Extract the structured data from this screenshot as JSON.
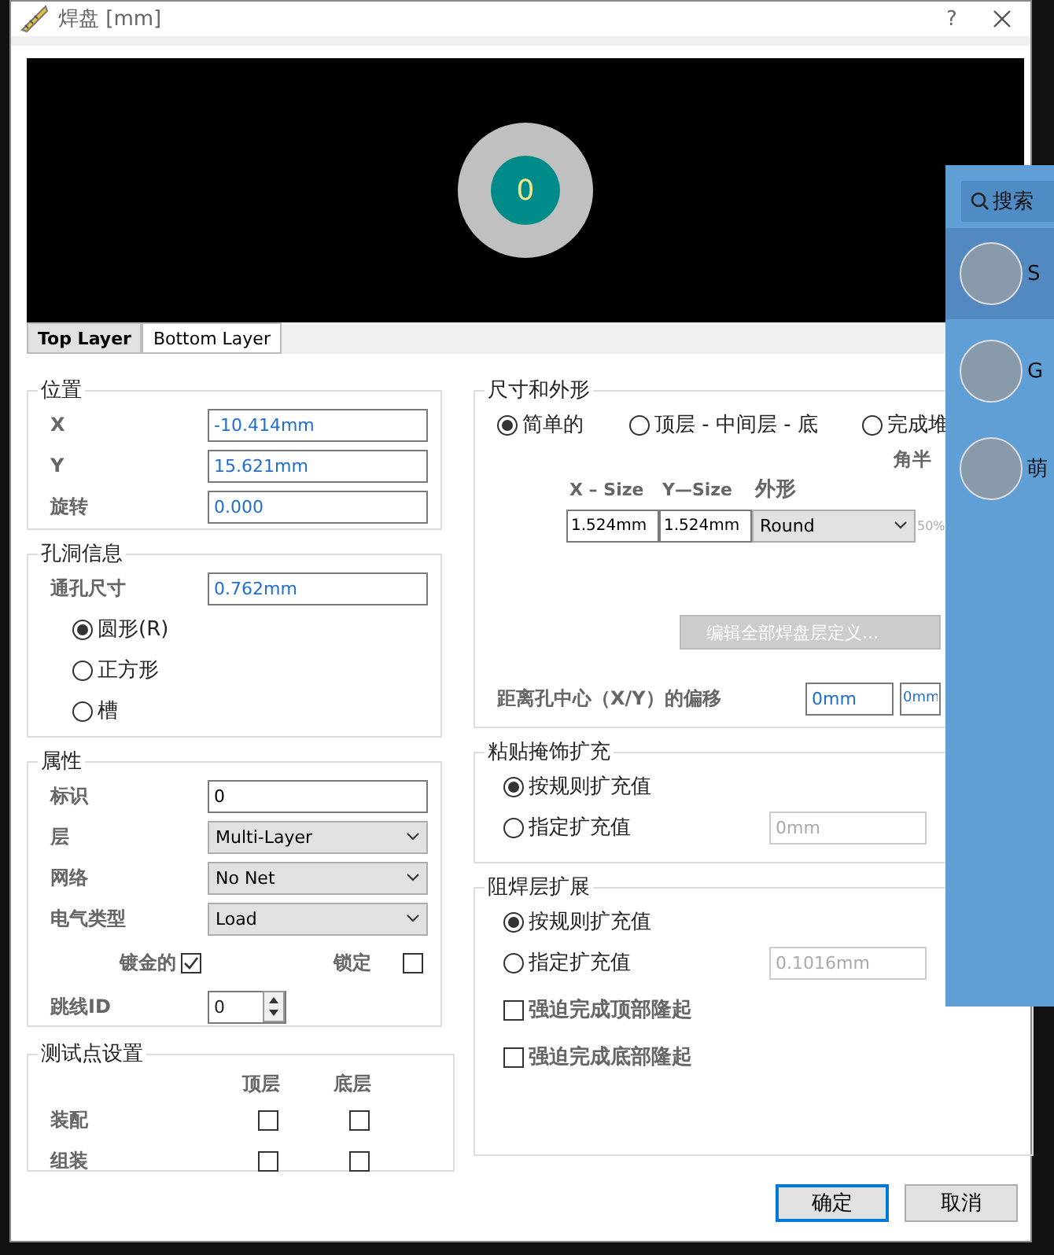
{
  "window": {
    "title": "焊盘 [mm]",
    "help": "?"
  },
  "preview": {
    "pad_label": "0",
    "tabs": [
      {
        "label": "Top Layer",
        "selected": true
      },
      {
        "label": "Bottom Layer",
        "selected": false
      }
    ]
  },
  "position": {
    "title": "位置",
    "fields": [
      {
        "label": "X",
        "value": "-10.414mm"
      },
      {
        "label": "Y",
        "value": "15.621mm"
      },
      {
        "label": "旋转",
        "value": "0.000"
      }
    ]
  },
  "hole": {
    "title": "孔洞信息",
    "size_label": "通孔尺寸",
    "size_value": "0.762mm",
    "shapes": [
      {
        "label": "圆形(R)",
        "selected": true
      },
      {
        "label": "正方形",
        "selected": false
      },
      {
        "label": "槽",
        "selected": false
      }
    ]
  },
  "properties": {
    "title": "属性",
    "fields": [
      {
        "kind": "input",
        "label": "标识",
        "value": "0"
      },
      {
        "kind": "select",
        "label": "层",
        "value": "Multi-Layer"
      },
      {
        "kind": "select",
        "label": "网络",
        "value": "No Net"
      },
      {
        "kind": "select",
        "label": "电气类型",
        "value": "Load"
      }
    ],
    "plated": {
      "label": "镀金的",
      "checked": true
    },
    "locked": {
      "label": "锁定",
      "checked": false
    },
    "jumper": {
      "label": "跳线ID",
      "value": "0"
    }
  },
  "testpoint": {
    "title": "测试点设置",
    "columns": [
      "顶层",
      "底层"
    ],
    "rows": [
      {
        "label": "装配",
        "checks": [
          {
            "checked": false
          },
          {
            "checked": false
          }
        ]
      },
      {
        "label": "组装",
        "checks": [
          {
            "checked": false
          },
          {
            "checked": false
          }
        ]
      }
    ]
  },
  "size_shape": {
    "title": "尺寸和外形",
    "modes": [
      {
        "label": "简单的",
        "selected": true
      },
      {
        "label": "顶层 - 中间层 - 底",
        "selected": false
      },
      {
        "label": "完成堆",
        "selected": false
      }
    ],
    "corner_label": "角半",
    "headers": [
      "X – Size",
      "Y—Size",
      "外形"
    ],
    "x_size": "1.524mm",
    "y_size": "1.524mm",
    "shape": "Round",
    "corner_value": "50%",
    "edit_button": "编辑全部焊盘层定义...",
    "offset_label": "距离孔中心（X/Y）的偏移",
    "offset_x": "0mm",
    "offset_y": "0mm"
  },
  "paste_mask": {
    "title": "粘贴掩饰扩充",
    "options": [
      {
        "label": "按规则扩充值",
        "selected": true
      },
      {
        "label": "指定扩充值",
        "selected": false
      }
    ],
    "value": "0mm"
  },
  "solder_mask": {
    "title": "阻焊层扩展",
    "options": [
      {
        "label": "按规则扩充值",
        "selected": true
      },
      {
        "label": "指定扩充值",
        "selected": false
      }
    ],
    "value": "0.1016mm",
    "checks": [
      {
        "label": "强迫完成顶部隆起",
        "checked": false
      },
      {
        "label": "强迫完成底部隆起",
        "checked": false
      }
    ]
  },
  "buttons": [
    {
      "label": "确定",
      "default": true
    },
    {
      "label": "取消",
      "default": false
    }
  ],
  "side_panel": {
    "search": "搜索",
    "contacts": [
      {
        "name": "S",
        "selected": true
      },
      {
        "name": "G",
        "selected": false
      },
      {
        "name": "萌",
        "selected": false
      }
    ]
  }
}
